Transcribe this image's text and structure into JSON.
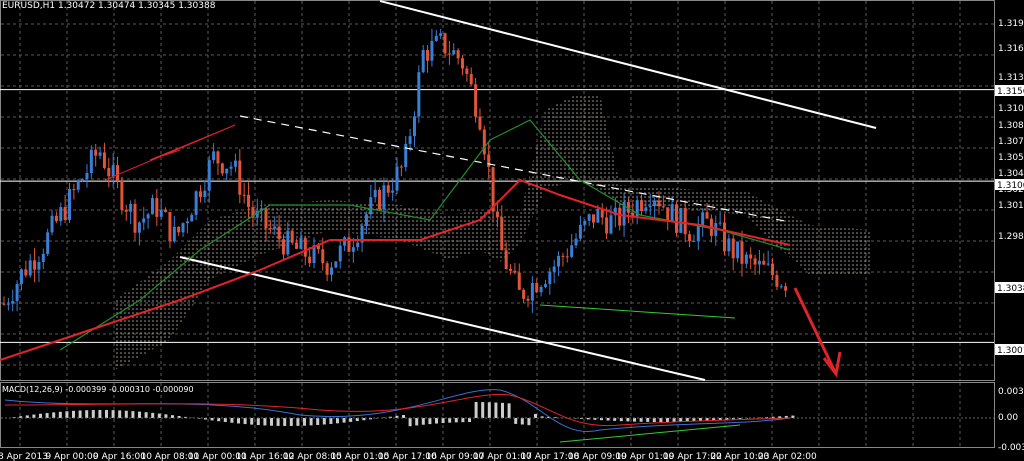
{
  "header": {
    "symbol_line": "EURUSD,H1  1.30472 1.30474 1.30345 1.30388"
  },
  "macd": {
    "title": "MACD(12,26,9) -0.000399 -0.000310 -0.000090",
    "y_labels": [
      "0.00342",
      "0.00",
      "-0.00347"
    ]
  },
  "price_axis": {
    "labels": [
      "1.31970",
      "1.31660",
      "1.31350",
      "1.31200",
      "1.31050",
      "1.30890",
      "1.30740",
      "1.30590",
      "1.30435",
      "1.30280",
      "1.30130",
      "1.29830"
    ],
    "tags": [
      {
        "label": "1.31568",
        "kind": "hline"
      },
      {
        "label": "1.31005",
        "kind": "hline"
      },
      {
        "label": "1.30388",
        "kind": "price"
      },
      {
        "label": "1.30012",
        "kind": "hline"
      }
    ]
  },
  "time_axis": [
    "8 Apr 2013",
    "9 Apr 00:00",
    "9 Apr 16:00",
    "10 Apr 08:00",
    "11 Apr 00:00",
    "11 Apr 16:00",
    "12 Apr 08:00",
    "15 Apr 01:00",
    "15 Apr 17:00",
    "16 Apr 09:00",
    "17 Apr 01:00",
    "17 Apr 17:00",
    "18 Apr 09:00",
    "19 Apr 01:00",
    "19 Apr 17:00",
    "22 Apr 10:00",
    "23 Apr 02:00"
  ],
  "colors": {
    "bg": "#000000",
    "grid": "#5a5a5a",
    "bull": "#3a7fd4",
    "bear": "#e0553a",
    "ma_red": "#e0242a",
    "ma_green": "#1f8f2a",
    "channel": "#ffffff",
    "cloud": "#c8b8a8",
    "arrow": "#e0242a"
  },
  "chart_data": {
    "type": "candlestick",
    "symbol": "EURUSD",
    "timeframe": "H1",
    "ohlc_header": {
      "open": 1.30472,
      "high": 1.30474,
      "low": 1.30345,
      "close": 1.30388
    },
    "price_range": [
      1.2978,
      1.3212
    ],
    "horizontal_lines": [
      1.31568,
      1.31005,
      1.30012
    ],
    "last_price": 1.30388,
    "approx_closes": [
      1.3025,
      1.3045,
      1.306,
      1.308,
      1.31,
      1.312,
      1.3095,
      1.3075,
      1.3085,
      1.3065,
      1.309,
      1.3115,
      1.311,
      1.308,
      1.307,
      1.306,
      1.3055,
      1.305,
      1.306,
      1.308,
      1.3095,
      1.311,
      1.318,
      1.3185,
      1.3175,
      1.314,
      1.306,
      1.303,
      1.304,
      1.305,
      1.3065,
      1.308,
      1.3075,
      1.3085,
      1.3095,
      1.308,
      1.307,
      1.3075,
      1.306,
      1.305,
      1.3045,
      1.3039
    ],
    "indicators": [
      "Ichimoku cloud",
      "MA red",
      "MA green",
      "MACD(12,26,9)"
    ]
  }
}
